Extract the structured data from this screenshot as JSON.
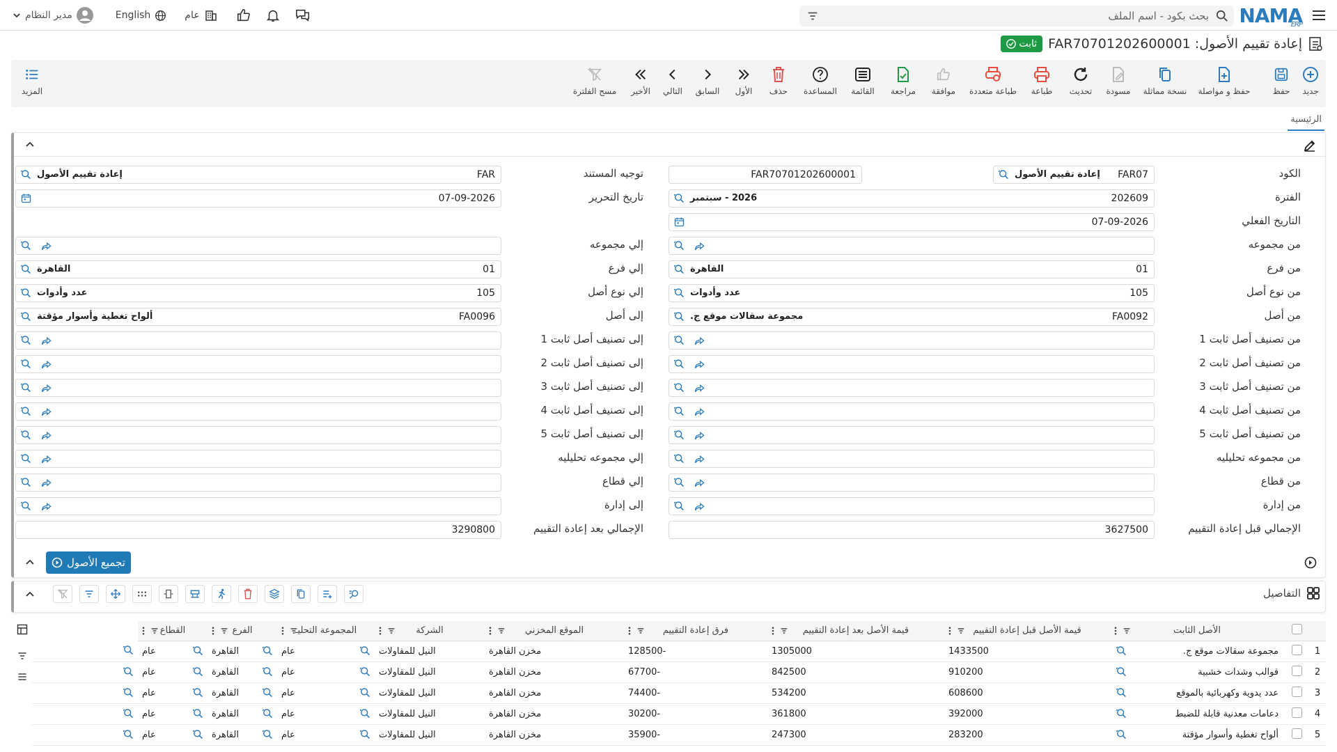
{
  "topbar": {
    "search_placeholder": "بحث بكود - اسم الملف",
    "logo": "NAMA",
    "logo_sub": "ERP",
    "user": "مدير النظام",
    "language": "English",
    "scope": "عام"
  },
  "title": {
    "text": "إعادة تقييم الأصول: FAR70701202600001",
    "status": "ثابت"
  },
  "toolbar": {
    "new": "جديد",
    "save": "حفظ",
    "save_continue": "حفظ و مواصلة",
    "copy": "نسخة مماثلة",
    "draft": "مسودة",
    "refresh": "تحديث",
    "print": "طباعة",
    "multi_print": "طباعة متعددة",
    "approve": "موافقة",
    "review": "مراجعة",
    "list": "القائمة",
    "help": "المساعدة",
    "delete": "حذف",
    "first": "الأول",
    "prev": "السابق",
    "next": "التالي",
    "last": "الأخير",
    "clear_filter": "مسح الفلترة",
    "more": "المزيد"
  },
  "tabs": {
    "main": "الرئيسية"
  },
  "form": {
    "labels": {
      "code": "الكود",
      "doc_direction": "توجيه المستند",
      "period": "الفترة",
      "edit_date": "تاريخ التحرير",
      "actual_date": "التاريخ الفعلي",
      "from_group": "من مجموعه",
      "to_group": "إلي مجموعه",
      "from_branch": "من فرع",
      "to_branch": "إلي فرع",
      "from_asset_type": "من نوع أصل",
      "to_asset_type": "إلي نوع أصل",
      "from_asset": "من أصل",
      "to_asset": "إلى أصل",
      "from_class1": "من تصنيف أصل ثابت 1",
      "to_class1": "إلى تصنيف أصل ثابت 1",
      "from_class2": "من تصنيف أصل ثابت 2",
      "to_class2": "إلى تصنيف أصل ثابت 2",
      "from_class3": "من تصنيف أصل ثابت 3",
      "to_class3": "إلى تصنيف أصل ثابت 3",
      "from_class4": "من تصنيف أصل ثابت 4",
      "to_class4": "إلى تصنيف أصل ثابت 4",
      "from_class5": "من تصنيف أصل ثابت 5",
      "to_class5": "إلى تصنيف أصل ثابت 5",
      "from_analytic": "من مجموعه تحليليه",
      "to_analytic": "إلي مجموعه تحليليه",
      "from_sector": "من قطاع",
      "to_sector": "إلي قطاع",
      "from_dept": "من إدارة",
      "to_dept": "إلى إدارة",
      "total_before": "الإجمالي قبل إعادة التقييم",
      "total_after": "الإجمالي بعد إعادة التقييم"
    },
    "values": {
      "code": "FAR07",
      "code_desc": "إعادة تقييم الأصول",
      "doc_no": "FAR70701202600001",
      "doc_direction": "FAR",
      "doc_direction_desc": "إعادة تقييم الأصول",
      "period": "202609",
      "period_desc": "2026 - سبتمبر",
      "edit_date": "07-09-2026",
      "actual_date": "07-09-2026",
      "from_branch": "01",
      "from_branch_desc": "القاهرة",
      "to_branch": "01",
      "to_branch_desc": "القاهرة",
      "from_asset_type": "105",
      "from_asset_type_desc": "عدد وأدوات",
      "to_asset_type": "105",
      "to_asset_type_desc": "عدد وأدوات",
      "from_asset": "FA0092",
      "from_asset_desc": "مجموعة سقالات موقع ج.",
      "to_asset": "FA0096",
      "to_asset_desc": "ألواح تغطية وأسوار مؤقتة",
      "total_before": "3627500",
      "total_after": "3290800"
    },
    "group_button": "تجميع الأصول"
  },
  "details": {
    "title": "التفاصيل",
    "columns": [
      "الأصل الثابت",
      "قيمة الأصل قبل إعادة التقييم",
      "قيمة الأصل بعد إعادة التقييم",
      "فرق إعادة التقييم",
      "الموقع المخزني",
      "الشركة",
      "المجموعة التحليـ",
      "الفرع",
      "القطاع"
    ],
    "rows": [
      {
        "n": "1",
        "asset": "مجموعة سقالات موقع ج.",
        "before": "1433500",
        "after": "1305000",
        "diff": "-128500",
        "loc": "مخزن القاهرة",
        "company": "النيل للمقاولات",
        "analytic": "عام",
        "branch": "القاهرة",
        "sector": "عام"
      },
      {
        "n": "2",
        "asset": "قوالب وشدات خشبية",
        "before": "910200",
        "after": "842500",
        "diff": "-67700",
        "loc": "مخزن القاهرة",
        "company": "النيل للمقاولات",
        "analytic": "عام",
        "branch": "القاهرة",
        "sector": "عام"
      },
      {
        "n": "3",
        "asset": "عدد يدوية وكهربائية بالموقع",
        "before": "608600",
        "after": "534200",
        "diff": "-74400",
        "loc": "مخزن القاهرة",
        "company": "النيل للمقاولات",
        "analytic": "عام",
        "branch": "القاهرة",
        "sector": "عام"
      },
      {
        "n": "4",
        "asset": "دعامات معدنية قابلة للضبط",
        "before": "392000",
        "after": "361800",
        "diff": "-30200",
        "loc": "مخزن القاهرة",
        "company": "النيل للمقاولات",
        "analytic": "عام",
        "branch": "القاهرة",
        "sector": "عام"
      },
      {
        "n": "5",
        "asset": "ألواح تغطية وأسوار مؤقتة",
        "before": "283200",
        "after": "247300",
        "diff": "-35900",
        "loc": "مخزن القاهرة",
        "company": "النيل للمقاولات",
        "analytic": "عام",
        "branch": "القاهرة",
        "sector": "عام"
      }
    ]
  },
  "colors": {
    "accent": "#2b7bbf",
    "status": "#1e9a45",
    "danger": "#d9534f",
    "button": "#1f7ab6"
  }
}
